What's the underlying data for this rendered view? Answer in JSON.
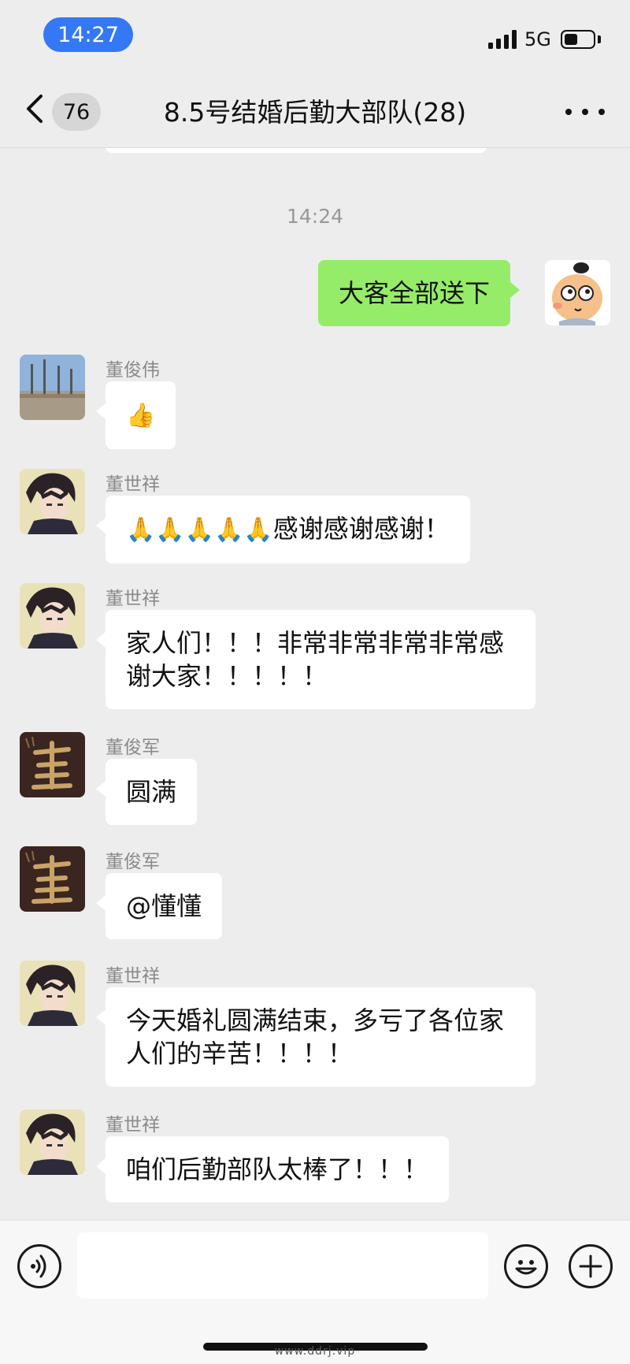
{
  "status_bar": {
    "time": "14:27",
    "network": "5G",
    "icons": [
      "signal-bars-icon",
      "battery-icon"
    ]
  },
  "nav": {
    "unread_count": "76",
    "title": "8.5号结婚后勤大部队(28)",
    "icons": [
      "back-chevron-icon",
      "more-dots-icon"
    ]
  },
  "chat": {
    "timestamp": "14:24",
    "messages": [
      {
        "direction": "out",
        "text": "大客全部送下"
      },
      {
        "direction": "in",
        "sender": "董俊伟",
        "text": "👍"
      },
      {
        "direction": "in",
        "sender": "董世祥",
        "emoji": "🙏🙏🙏🙏🙏",
        "text": "感谢感谢感谢！"
      },
      {
        "direction": "in",
        "sender": "董世祥",
        "text": "家人们！！！非常非常非常非常感谢大家！！！！！"
      },
      {
        "direction": "in",
        "sender": "董俊军",
        "text": "圆满"
      },
      {
        "direction": "in",
        "sender": "董俊军",
        "text": "@懂懂"
      },
      {
        "direction": "in",
        "sender": "董世祥",
        "text": "今天婚礼圆满结束，多亏了各位家人们的辛苦！！！！"
      },
      {
        "direction": "in",
        "sender": "董世祥",
        "text": "咱们后勤部队太棒了！！！"
      }
    ]
  },
  "composer": {
    "input_value": "",
    "icons": [
      "voice-icon",
      "emoji-icon",
      "plus-icon"
    ]
  },
  "watermark": "www.ddrj.vip",
  "colors": {
    "background": "#ededed",
    "outgoing_bubble": "#95ec69",
    "incoming_bubble": "#ffffff",
    "time_pill": "#3478f6"
  }
}
